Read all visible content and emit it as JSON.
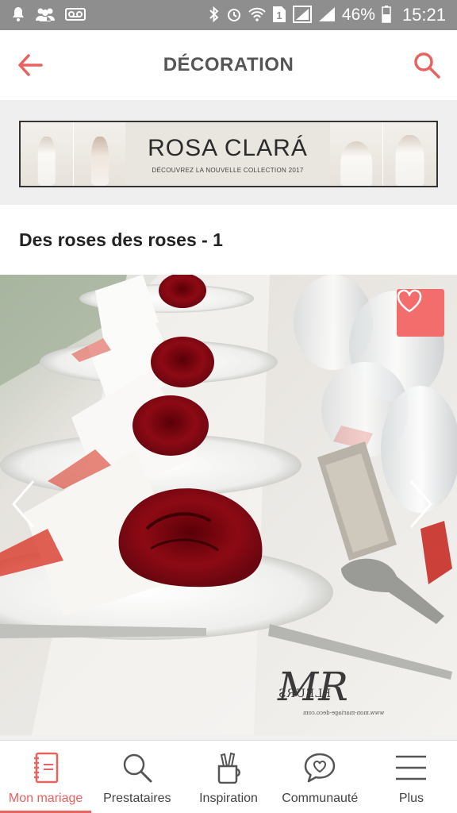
{
  "status_bar": {
    "battery_pct": "46%",
    "time": "15:21",
    "sim_number": "1"
  },
  "app_bar": {
    "title": "DÉCORATION"
  },
  "ad_banner": {
    "brand": "ROSA CLARÁ",
    "tagline": "DÉCOUVREZ LA NOUVELLE COLLECTION 2017"
  },
  "gallery": {
    "title": "Des roses des roses - 1",
    "watermark_name": "FLEURS",
    "watermark_url": "www.mon-mariage-deco.com"
  },
  "bottom_nav": {
    "items": [
      {
        "label": "Mon mariage",
        "icon": "notebook-icon",
        "active": true
      },
      {
        "label": "Prestataires",
        "icon": "search-icon",
        "active": false
      },
      {
        "label": "Inspiration",
        "icon": "pencil-cup-icon",
        "active": false
      },
      {
        "label": "Communauté",
        "icon": "chat-heart-icon",
        "active": false
      },
      {
        "label": "Plus",
        "icon": "menu-icon",
        "active": false
      }
    ]
  },
  "colors": {
    "accent": "#e8625f",
    "status_bar": "#8e8e8e",
    "fav_button": "#f46d6d"
  }
}
